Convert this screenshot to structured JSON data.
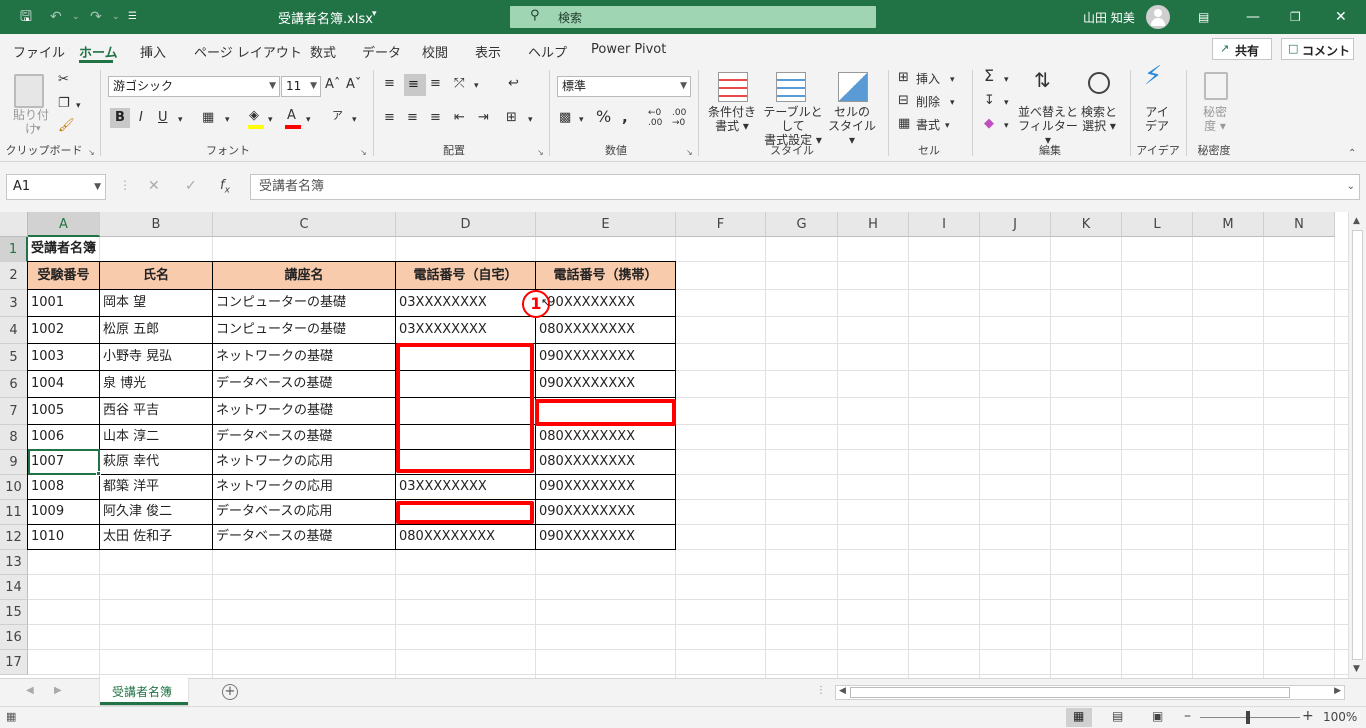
{
  "window": {
    "file_title": "受講者名簿.xlsx",
    "search_placeholder": "検索",
    "user_name": "山田 知美"
  },
  "menu": [
    "ファイル",
    "ホーム",
    "挿入",
    "ページ レイアウト",
    "数式",
    "データ",
    "校閲",
    "表示",
    "ヘルプ",
    "Power Pivot"
  ],
  "share_label": "共有",
  "comment_label": "コメント",
  "ribbon": {
    "paste_label": "貼り付け",
    "clipboard_group": "クリップボード",
    "font_name": "游ゴシック",
    "font_size": "11",
    "font_group": "フォント",
    "align_group": "配置",
    "number_format": "標準",
    "number_group": "数値",
    "cond_format": [
      "条件付き",
      "書式"
    ],
    "table_format": [
      "テーブルとして",
      "書式設定"
    ],
    "cell_style": [
      "セルの",
      "スタイル"
    ],
    "style_group": "スタイル",
    "insert_label": "挿入",
    "delete_label": "削除",
    "format_label": "書式",
    "cells_group": "セル",
    "sort_filter": [
      "並べ替えと",
      "フィルター"
    ],
    "find_select": [
      "検索と",
      "選択"
    ],
    "edit_group": "編集",
    "ideas": [
      "アイ",
      "デア"
    ],
    "ideas_group": "アイデア",
    "sensitivity": [
      "秘密",
      "度"
    ],
    "sensitivity_group": "秘密度"
  },
  "formula_bar": {
    "name_box": "A1",
    "content": "受講者名簿"
  },
  "columns": [
    "A",
    "B",
    "C",
    "D",
    "E",
    "F",
    "G",
    "H",
    "I",
    "J",
    "K",
    "L",
    "M",
    "N"
  ],
  "rows": [
    "1",
    "2",
    "3",
    "4",
    "5",
    "6",
    "7",
    "8",
    "9",
    "10",
    "11",
    "12",
    "13",
    "14",
    "15",
    "16",
    "17"
  ],
  "table": {
    "title": "受講者名簿",
    "headers": [
      "受験番号",
      "氏名",
      "講座名",
      "電話番号（自宅）",
      "電話番号（携帯）"
    ],
    "data": [
      [
        "1001",
        "岡本 望",
        "コンピューターの基礎",
        "03XXXXXXXX",
        "090XXXXXXXX"
      ],
      [
        "1002",
        "松原 五郎",
        "コンピューターの基礎",
        "03XXXXXXXX",
        "080XXXXXXXX"
      ],
      [
        "1003",
        "小野寺 晃弘",
        "ネットワークの基礎",
        "",
        "090XXXXXXXX"
      ],
      [
        "1004",
        "泉 博光",
        "データベースの基礎",
        "",
        "090XXXXXXXX"
      ],
      [
        "1005",
        "西谷 平吉",
        "ネットワークの基礎",
        "",
        ""
      ],
      [
        "1006",
        "山本 淳二",
        "データベースの基礎",
        "",
        "080XXXXXXXX"
      ],
      [
        "1007",
        "萩原 幸代",
        "ネットワークの応用",
        "",
        "080XXXXXXXX"
      ],
      [
        "1008",
        "都築 洋平",
        "ネットワークの応用",
        "03XXXXXXXX",
        "090XXXXXXXX"
      ],
      [
        "1009",
        "阿久津 俊二",
        "データベースの応用",
        "",
        "090XXXXXXXX"
      ],
      [
        "1010",
        "太田 佐和子",
        "データベースの基礎",
        "080XXXXXXXX",
        "090XXXXXXXX"
      ]
    ]
  },
  "annotation_marker": "1",
  "sheet_tab": "受講者名簿",
  "zoom": "100%",
  "colors": {
    "excel_green": "#217346",
    "header_fill": "#f8cbad",
    "highlight": "#ff0000"
  }
}
